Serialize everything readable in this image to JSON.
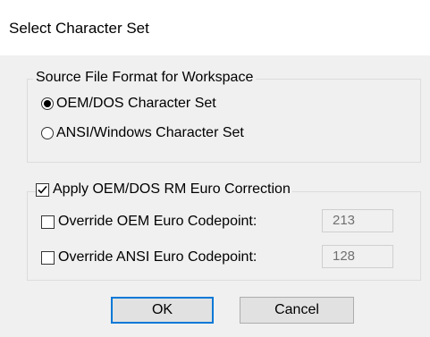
{
  "dialog": {
    "title": "Select Character Set"
  },
  "source_format": {
    "legend": "Source File Format for Workspace",
    "options": [
      {
        "label": "OEM/DOS Character Set",
        "selected": true
      },
      {
        "label": "ANSI/Windows Character Set",
        "selected": false
      }
    ]
  },
  "euro": {
    "apply_label": "Apply OEM/DOS RM Euro Correction",
    "apply_checked": true,
    "override_oem_label": "Override OEM Euro Codepoint:",
    "override_oem_checked": false,
    "override_oem_value": "213",
    "override_ansi_label": "Override ANSI Euro Codepoint:",
    "override_ansi_checked": false,
    "override_ansi_value": "128"
  },
  "buttons": {
    "ok": "OK",
    "cancel": "Cancel"
  },
  "colors": {
    "dialog_bg": "#f0f0f0",
    "title_bg": "#ffffff",
    "focus_border": "#0078d7"
  }
}
